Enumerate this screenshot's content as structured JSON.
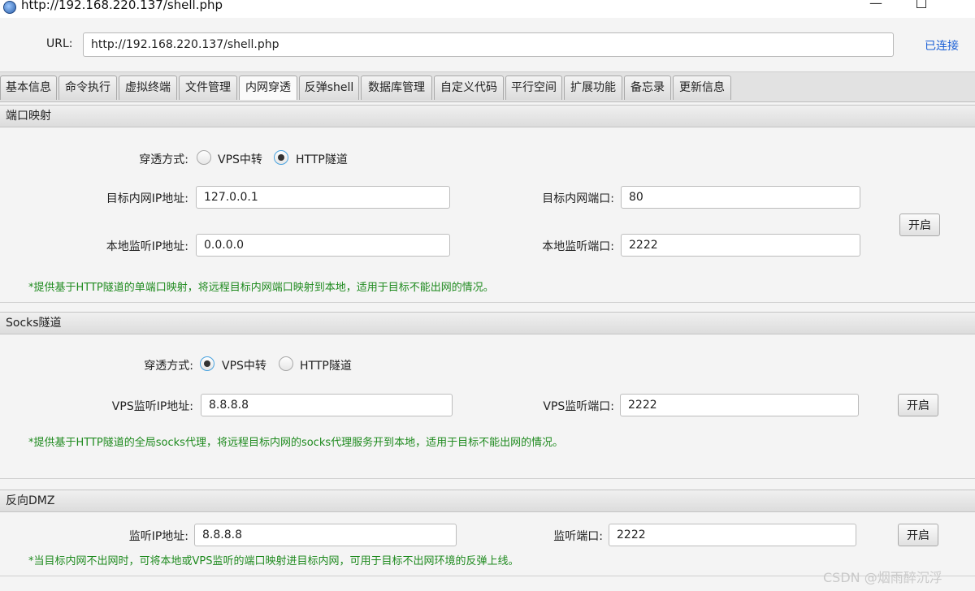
{
  "window": {
    "title": "http://192.168.220.137/shell.php",
    "minimize_glyph": "—"
  },
  "urlbar": {
    "label": "URL:",
    "value": "http://192.168.220.137/shell.php",
    "status": "已连接"
  },
  "tabs": [
    {
      "label": "基本信息"
    },
    {
      "label": "命令执行"
    },
    {
      "label": "虚拟终端"
    },
    {
      "label": "文件管理"
    },
    {
      "label": "内网穿透",
      "active": true
    },
    {
      "label": "反弹shell"
    },
    {
      "label": "数据库管理"
    },
    {
      "label": "自定义代码"
    },
    {
      "label": "平行空间"
    },
    {
      "label": "扩展功能"
    },
    {
      "label": "备忘录"
    },
    {
      "label": "更新信息"
    }
  ],
  "port_mapping": {
    "title": "端口映射",
    "mode_label": "穿透方式:",
    "mode_options": [
      "VPS中转",
      "HTTP隧道"
    ],
    "mode_selected": "HTTP隧道",
    "target_ip_label": "目标内网IP地址:",
    "target_ip": "127.0.0.1",
    "target_port_label": "目标内网端口:",
    "target_port": "80",
    "local_ip_label": "本地监听IP地址:",
    "local_ip": "0.0.0.0",
    "local_port_label": "本地监听端口:",
    "local_port": "2222",
    "start_button": "开启",
    "note": "*提供基于HTTP隧道的单端口映射，将远程目标内网端口映射到本地，适用于目标不能出网的情况。"
  },
  "socks_tunnel": {
    "title": "Socks隧道",
    "mode_label": "穿透方式:",
    "mode_options": [
      "VPS中转",
      "HTTP隧道"
    ],
    "mode_selected": "VPS中转",
    "vps_ip_label": "VPS监听IP地址:",
    "vps_ip": "8.8.8.8",
    "vps_port_label": "VPS监听端口:",
    "vps_port": "2222",
    "start_button": "开启",
    "note": "*提供基于HTTP隧道的全局socks代理，将远程目标内网的socks代理服务开到本地，适用于目标不能出网的情况。"
  },
  "reverse_dmz": {
    "title": "反向DMZ",
    "listen_ip_label": "监听IP地址:",
    "listen_ip": "8.8.8.8",
    "listen_port_label": "监听端口:",
    "listen_port": "2222",
    "start_button": "开启",
    "note": "*当目标内网不出网时，可将本地或VPS监听的端口映射进目标内网，可用于目标不出网环境的反弹上线。"
  },
  "watermark": "CSDN @烟雨醉沉浮",
  "icons": {
    "app": "globe-icon",
    "minimize": "minimize-icon",
    "maximize": "maximize-icon"
  }
}
